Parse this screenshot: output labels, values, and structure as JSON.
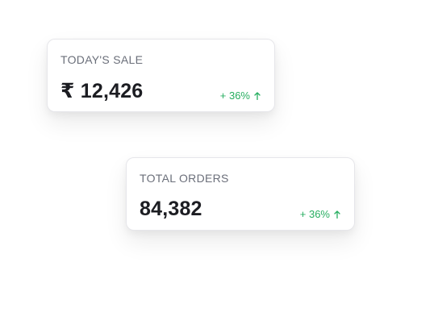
{
  "cards": {
    "sale": {
      "title": "TODAY'S SALE",
      "value": "₹ 12,426",
      "change": "+ 36%",
      "trend_icon": "arrow-up-icon"
    },
    "orders": {
      "title": "TOTAL ORDERS",
      "value": "84,382",
      "change": "+ 36%",
      "trend_icon": "arrow-up-icon"
    }
  },
  "colors": {
    "positive": "#27ae60",
    "title": "#6b6f7a",
    "value": "#1c1d22",
    "card_border": "#e6e6ea"
  }
}
